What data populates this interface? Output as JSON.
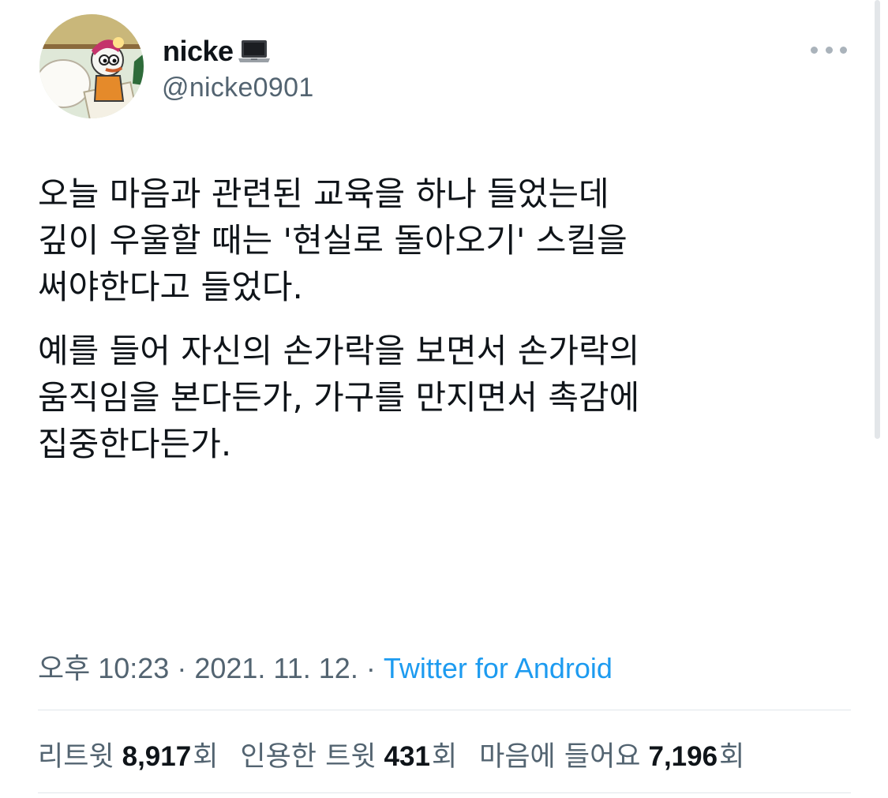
{
  "user": {
    "display_name": "nicke",
    "name_emoji_icon": "laptop-icon",
    "handle": "@nicke0901"
  },
  "tweet": {
    "paragraph1": [
      "오늘 마음과 관련된 교육을 하나 들었는데",
      "깊이 우울할 때는 '현실로 돌아오기' 스킬을",
      "써야한다고 들었다."
    ],
    "paragraph2": [
      "예를 들어 자신의 손가락을 보면서 손가락의",
      "움직임을 본다든가, 가구를 만지면서 촉감에",
      "집중한다든가."
    ]
  },
  "meta": {
    "time_date": "오후 10:23 · 2021. 11. 12. · ",
    "source": "Twitter for Android"
  },
  "stats": {
    "retweets_label": "리트윗",
    "retweets_count": "8,917",
    "retweets_unit": "회",
    "quotes_label": "인용한 트윗",
    "quotes_count": "431",
    "quotes_unit": "회",
    "likes_label": "마음에 들어요",
    "likes_count": "7,196",
    "likes_unit": "회"
  },
  "colors": {
    "text": "#0f1419",
    "secondary": "#536471",
    "link": "#1d9bf0",
    "divider": "#e1e6ea"
  }
}
